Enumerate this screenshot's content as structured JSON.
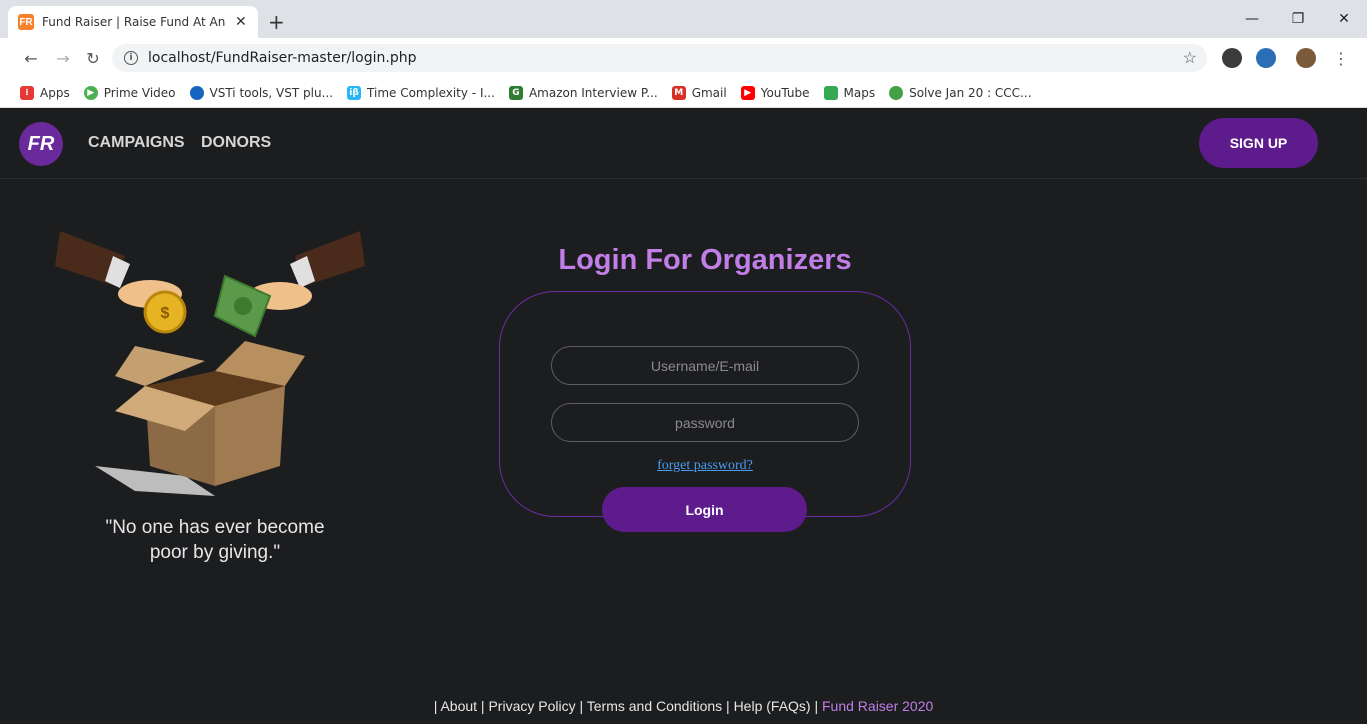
{
  "browser": {
    "tab_title": "Fund Raiser | Raise Fund At An Easy Way",
    "tab_favicon": "FR",
    "url": "localhost/FundRaiser-master/login.php",
    "bookmarks": [
      {
        "label": "Apps",
        "icon": "apps-grid-icon",
        "color": "#e53935"
      },
      {
        "label": "Prime Video",
        "icon": "play-icon",
        "color": "#4caf50"
      },
      {
        "label": "VSTi tools, VST plu...",
        "icon": "globe-icon",
        "color": "#1565c0"
      },
      {
        "label": "Time Complexity - I...",
        "icon": "ib-icon",
        "color": "#29b6f6"
      },
      {
        "label": "Amazon Interview P...",
        "icon": "gfg-icon",
        "color": "#2e7d32"
      },
      {
        "label": "Gmail",
        "icon": "gmail-icon",
        "color": "#d93025"
      },
      {
        "label": "YouTube",
        "icon": "youtube-icon",
        "color": "#ff0000"
      },
      {
        "label": "Maps",
        "icon": "maps-icon",
        "color": "#34a853"
      },
      {
        "label": "Solve Jan 20 : CCC...",
        "icon": "solve-icon",
        "color": "#43a047"
      }
    ]
  },
  "nav": {
    "logo_text": "FR",
    "links": [
      "CAMPAIGNS",
      "DONORS"
    ],
    "signup_label": "SIGN UP"
  },
  "hero": {
    "quote_line1": "\"No one has ever become",
    "quote_line2": "poor by giving.\""
  },
  "login": {
    "title": "Login For Organizers",
    "username_placeholder": "Username/E-mail",
    "password_placeholder": "password",
    "forgot_label": "forget password?",
    "button_label": "Login"
  },
  "footer": {
    "links_text": "| About | Privacy Policy | Terms and Conditions | Help (FAQs) | ",
    "brand": "Fund Raiser 2020"
  },
  "colors": {
    "background": "#1c1d1f",
    "accent": "#5e1b8c",
    "title": "#c07ee6",
    "link": "#4a9cf0"
  }
}
